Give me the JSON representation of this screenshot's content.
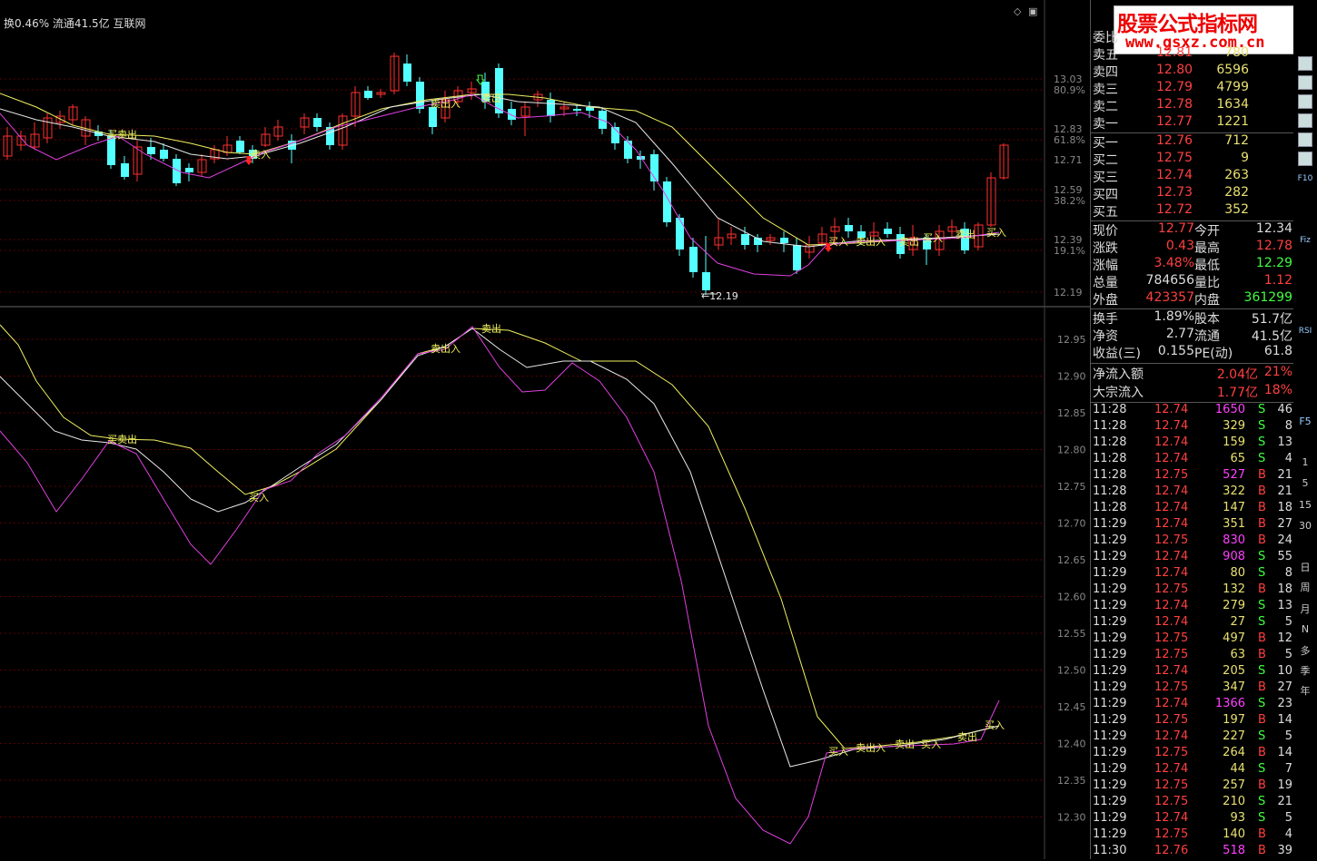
{
  "header": {
    "text": "换0.46% 流通41.5亿 互联网"
  },
  "ctl_icons": [
    "◇",
    "▣"
  ],
  "watermark": {
    "line1": "股票公式指标网",
    "line2": "www.gsxz.com.cn"
  },
  "price_axis": {
    "upper": [
      "13.03",
      "80.9%",
      "12.83",
      "61.8%",
      "12.71",
      "12.59",
      "38.2%",
      "12.39",
      "19.1%",
      "12.19"
    ],
    "lower": [
      "12.95",
      "12.90",
      "12.85",
      "12.80",
      "12.75",
      "12.70",
      "12.65",
      "12.60",
      "12.55",
      "12.50",
      "12.45",
      "12.40",
      "12.35",
      "12.30"
    ]
  },
  "annotations": {
    "upper": [
      {
        "t": "买卖出",
        "c": "yellow"
      },
      {
        "t": "卖入",
        "c": "yellow"
      },
      {
        "t": "卖出入",
        "c": "yellow"
      },
      {
        "t": "卖出",
        "c": "yellow"
      },
      {
        "t": "买入",
        "c": "yellow"
      },
      {
        "t": "卖出入",
        "c": "yellow"
      },
      {
        "t": "卖出",
        "c": "yellow"
      },
      {
        "t": "买入",
        "c": "yellow"
      },
      {
        "t": "卖出",
        "c": "yellow"
      },
      {
        "t": "买入",
        "c": "yellow"
      },
      {
        "t": "←12.19",
        "c": "white"
      }
    ],
    "lower": [
      {
        "t": "买卖出",
        "c": "yellow"
      },
      {
        "t": "买入",
        "c": "yellow"
      },
      {
        "t": "卖出入",
        "c": "yellow"
      },
      {
        "t": "卖出",
        "c": "yellow"
      },
      {
        "t": "买入",
        "c": "yellow"
      },
      {
        "t": "卖出入",
        "c": "yellow"
      },
      {
        "t": "卖出",
        "c": "yellow"
      },
      {
        "t": "买入",
        "c": "yellow"
      },
      {
        "t": "卖出",
        "c": "yellow"
      },
      {
        "t": "买入",
        "c": "yellow"
      }
    ]
  },
  "orderbook": {
    "label_top": "委比",
    "sells": [
      {
        "label": "卖五",
        "price": "12.81",
        "vol": "780"
      },
      {
        "label": "卖四",
        "price": "12.80",
        "vol": "6596"
      },
      {
        "label": "卖三",
        "price": "12.79",
        "vol": "4799"
      },
      {
        "label": "卖二",
        "price": "12.78",
        "vol": "1634"
      },
      {
        "label": "卖一",
        "price": "12.77",
        "vol": "1221"
      }
    ],
    "buys": [
      {
        "label": "买一",
        "price": "12.76",
        "vol": "712"
      },
      {
        "label": "买二",
        "price": "12.75",
        "vol": "9"
      },
      {
        "label": "买三",
        "price": "12.74",
        "vol": "263"
      },
      {
        "label": "买四",
        "price": "12.73",
        "vol": "282"
      },
      {
        "label": "买五",
        "price": "12.72",
        "vol": "352"
      }
    ]
  },
  "quote": [
    {
      "l1": "现价",
      "v1": "12.77",
      "c1": "#ff4040",
      "l2": "今开",
      "v2": "12.34",
      "c2": "#dddddd"
    },
    {
      "l1": "涨跌",
      "v1": "0.43",
      "c1": "#ff4040",
      "l2": "最高",
      "v2": "12.78",
      "c2": "#ff4040"
    },
    {
      "l1": "涨幅",
      "v1": "3.48%",
      "c1": "#ff4040",
      "l2": "最低",
      "v2": "12.29",
      "c2": "#40ff40"
    },
    {
      "l1": "总量",
      "v1": "784656",
      "c1": "#dddddd",
      "l2": "量比",
      "v2": "1.12",
      "c2": "#ff4040"
    },
    {
      "l1": "外盘",
      "v1": "423357",
      "c1": "#ff4040",
      "l2": "内盘",
      "v2": "361299",
      "c2": "#40ff40"
    }
  ],
  "fundamentals": [
    {
      "l1": "换手",
      "v1": "1.89%",
      "l2": "股本",
      "v2": "51.7亿"
    },
    {
      "l1": "净资",
      "v1": "2.77",
      "l2": "流通",
      "v2": "41.5亿"
    },
    {
      "l1": "收益(三)",
      "v1": "0.155",
      "l2": "PE(动)",
      "v2": "61.8"
    }
  ],
  "flows": [
    {
      "l": "净流入额",
      "v": "2.04亿",
      "p": "21%"
    },
    {
      "l": "大宗流入",
      "v": "1.77亿",
      "p": "18%"
    }
  ],
  "ticks": [
    {
      "t": "11:28",
      "p": "12.74",
      "pc": "#ff4040",
      "v": "1650",
      "vc": "#ff40ff",
      "s": "S",
      "n": "46"
    },
    {
      "t": "11:28",
      "p": "12.74",
      "pc": "#ff4040",
      "v": "329",
      "vc": "#e8e070",
      "s": "S",
      "n": "8"
    },
    {
      "t": "11:28",
      "p": "12.74",
      "pc": "#ff4040",
      "v": "159",
      "vc": "#e8e070",
      "s": "S",
      "n": "13"
    },
    {
      "t": "11:28",
      "p": "12.74",
      "pc": "#ff4040",
      "v": "65",
      "vc": "#e8e070",
      "s": "S",
      "n": "4"
    },
    {
      "t": "11:28",
      "p": "12.75",
      "pc": "#ff4040",
      "v": "527",
      "vc": "#ff40ff",
      "s": "B",
      "n": "21"
    },
    {
      "t": "11:28",
      "p": "12.74",
      "pc": "#ff4040",
      "v": "322",
      "vc": "#e8e070",
      "s": "B",
      "n": "21"
    },
    {
      "t": "11:28",
      "p": "12.74",
      "pc": "#ff4040",
      "v": "147",
      "vc": "#e8e070",
      "s": "B",
      "n": "18"
    },
    {
      "t": "11:29",
      "p": "12.74",
      "pc": "#ff4040",
      "v": "351",
      "vc": "#e8e070",
      "s": "B",
      "n": "27"
    },
    {
      "t": "11:29",
      "p": "12.75",
      "pc": "#ff4040",
      "v": "830",
      "vc": "#ff40ff",
      "s": "B",
      "n": "24"
    },
    {
      "t": "11:29",
      "p": "12.74",
      "pc": "#ff4040",
      "v": "908",
      "vc": "#ff40ff",
      "s": "S",
      "n": "55"
    },
    {
      "t": "11:29",
      "p": "12.74",
      "pc": "#ff4040",
      "v": "80",
      "vc": "#e8e070",
      "s": "S",
      "n": "8"
    },
    {
      "t": "11:29",
      "p": "12.75",
      "pc": "#ff4040",
      "v": "132",
      "vc": "#e8e070",
      "s": "B",
      "n": "18"
    },
    {
      "t": "11:29",
      "p": "12.74",
      "pc": "#ff4040",
      "v": "279",
      "vc": "#e8e070",
      "s": "S",
      "n": "13"
    },
    {
      "t": "11:29",
      "p": "12.74",
      "pc": "#ff4040",
      "v": "27",
      "vc": "#e8e070",
      "s": "S",
      "n": "5"
    },
    {
      "t": "11:29",
      "p": "12.75",
      "pc": "#ff4040",
      "v": "497",
      "vc": "#e8e070",
      "s": "B",
      "n": "12"
    },
    {
      "t": "11:29",
      "p": "12.75",
      "pc": "#ff4040",
      "v": "63",
      "vc": "#e8e070",
      "s": "B",
      "n": "5"
    },
    {
      "t": "11:29",
      "p": "12.74",
      "pc": "#ff4040",
      "v": "205",
      "vc": "#e8e070",
      "s": "S",
      "n": "10"
    },
    {
      "t": "11:29",
      "p": "12.75",
      "pc": "#ff4040",
      "v": "347",
      "vc": "#e8e070",
      "s": "B",
      "n": "27"
    },
    {
      "t": "11:29",
      "p": "12.74",
      "pc": "#ff4040",
      "v": "1366",
      "vc": "#ff40ff",
      "s": "S",
      "n": "23"
    },
    {
      "t": "11:29",
      "p": "12.75",
      "pc": "#ff4040",
      "v": "197",
      "vc": "#e8e070",
      "s": "B",
      "n": "14"
    },
    {
      "t": "11:29",
      "p": "12.74",
      "pc": "#ff4040",
      "v": "227",
      "vc": "#e8e070",
      "s": "S",
      "n": "5"
    },
    {
      "t": "11:29",
      "p": "12.75",
      "pc": "#ff4040",
      "v": "264",
      "vc": "#e8e070",
      "s": "B",
      "n": "14"
    },
    {
      "t": "11:29",
      "p": "12.74",
      "pc": "#ff4040",
      "v": "44",
      "vc": "#e8e070",
      "s": "S",
      "n": "7"
    },
    {
      "t": "11:29",
      "p": "12.75",
      "pc": "#ff4040",
      "v": "257",
      "vc": "#e8e070",
      "s": "B",
      "n": "19"
    },
    {
      "t": "11:29",
      "p": "12.75",
      "pc": "#ff4040",
      "v": "210",
      "vc": "#e8e070",
      "s": "S",
      "n": "21"
    },
    {
      "t": "11:29",
      "p": "12.74",
      "pc": "#ff4040",
      "v": "93",
      "vc": "#e8e070",
      "s": "S",
      "n": "5"
    },
    {
      "t": "11:29",
      "p": "12.75",
      "pc": "#ff4040",
      "v": "140",
      "vc": "#e8e070",
      "s": "B",
      "n": "4"
    },
    {
      "t": "11:30",
      "p": "12.76",
      "pc": "#ff4040",
      "v": "518",
      "vc": "#ff40ff",
      "s": "B",
      "n": "39"
    }
  ],
  "toolbar": [
    "F10",
    "Fiz",
    "RSI",
    "F5",
    "1",
    "5",
    "15",
    "30",
    "日",
    "周",
    "月",
    "N",
    "多",
    "季",
    "年"
  ],
  "colors": {
    "up": "#ff3030",
    "down": "#54ffff",
    "magenta": "#e040e0",
    "yellow": "#f0f060",
    "white": "#e8e8e8",
    "grid": "#5a0000"
  },
  "chart_data": {
    "type": "candlestick",
    "upper_ylim": [
      12.19,
      13.03
    ],
    "lower_ylim": [
      12.28,
      12.98
    ],
    "note_low": "12.19"
  }
}
